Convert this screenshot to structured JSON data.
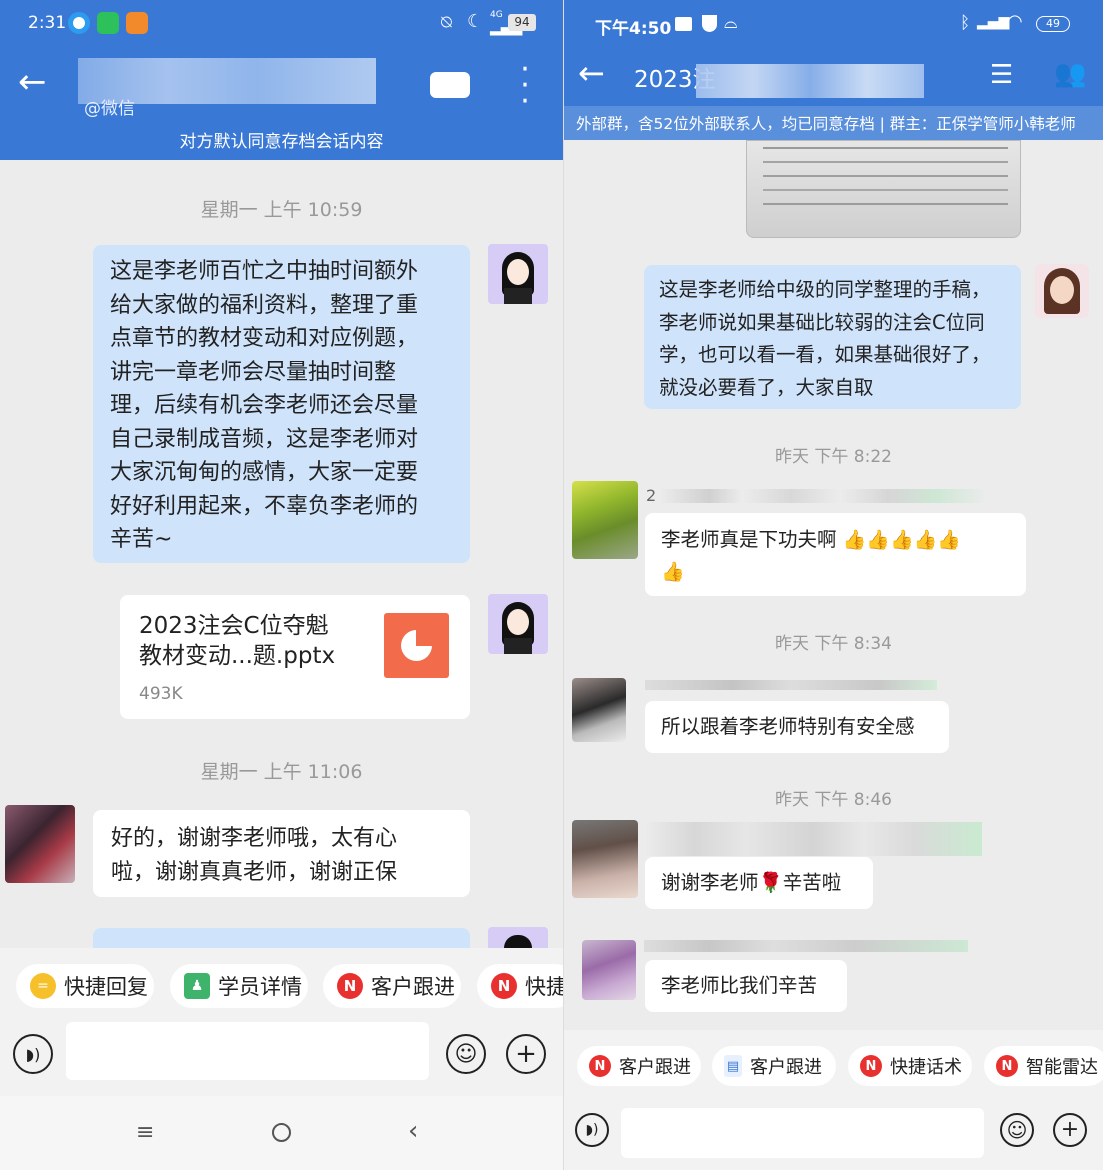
{
  "left": {
    "status": {
      "time": "2:31",
      "battery": "94",
      "network": "4G"
    },
    "header": {
      "subtitle": "@微信"
    },
    "notice": "对方默认同意存档会话内容",
    "time1": "星期一  上午 10:59",
    "msg1_lines": [
      "这是李老师百忙之中抽时间额外",
      "给大家做的福利资料，整理了重",
      "点章节的教材变动和对应例题，",
      "讲完一章老师会尽量抽时间整",
      "理，后续有机会李老师还会尽量",
      "自己录制成音频，这是李老师对",
      "大家沉甸甸的感情，大家一定要",
      "好好利用起来，不辜负李老师的",
      "辛苦~"
    ],
    "file": {
      "name_line1": "2023注会C位夺魁",
      "name_line2": "教材变动...题.pptx",
      "size": "493K"
    },
    "time2": "星期一  上午 11:06",
    "msg2_lines": [
      "好的，谢谢李老师哦，太有心",
      "啦，谢谢真真老师，谢谢正保"
    ],
    "quick": [
      "快捷回复",
      "学员详情",
      "客户跟进",
      "快捷"
    ]
  },
  "right": {
    "status": {
      "time": "下午4:50",
      "battery": "49"
    },
    "header": {
      "title": "2023注"
    },
    "notice": "外部群，含52位外部联系人，均已同意存档 | 群主：正保学管师小韩老师",
    "msg1_lines": [
      "这是李老师给中级的同学整理的手稿，",
      "李老师说如果基础比较弱的注会C位同",
      "学，也可以看一看，如果基础很好了，",
      "就没必要看了，大家自取"
    ],
    "time1": "昨天  下午 8:22",
    "sender1": "2",
    "msg2": "李老师真是下功夫啊",
    "time2": "昨天  下午 8:34",
    "msg3": "所以跟着李老师特别有安全感",
    "time3": "昨天  下午 8:46",
    "msg4a": "谢谢李老师",
    "msg4b": "辛苦啦",
    "msg5": "李老师比我们辛苦",
    "quick": [
      "客户跟进",
      "客户跟进",
      "快捷话术",
      "智能雷达"
    ]
  },
  "colors": {
    "header_blue": "#3a78d6",
    "bubble_blue": "#cfe3fb",
    "file_orange": "#f26b4b",
    "chip_red": "#e8312f"
  }
}
